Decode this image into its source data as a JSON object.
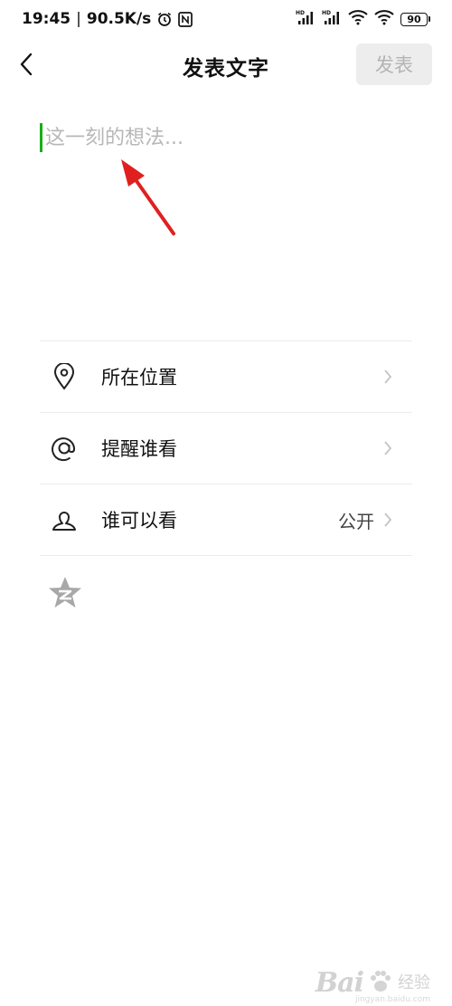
{
  "status_bar": {
    "time": "19:45",
    "separator": "|",
    "speed": "90.5K/s",
    "battery_level": "90"
  },
  "nav": {
    "title": "发表文字",
    "publish_label": "发表"
  },
  "compose": {
    "placeholder": "这一刻的想法..."
  },
  "options": [
    {
      "label": "所在位置",
      "value": "",
      "icon": "location-pin-icon"
    },
    {
      "label": "提醒谁看",
      "value": "",
      "icon": "at-sign-icon"
    },
    {
      "label": "谁可以看",
      "value": "公开",
      "icon": "person-icon"
    }
  ],
  "watermark": {
    "brand": "Bai",
    "suffix": "经验",
    "url": "jingyan.baidu.com"
  },
  "colors": {
    "cursor": "#1aad19",
    "annotation_arrow": "#e02020",
    "publish_disabled_bg": "#ededed"
  }
}
